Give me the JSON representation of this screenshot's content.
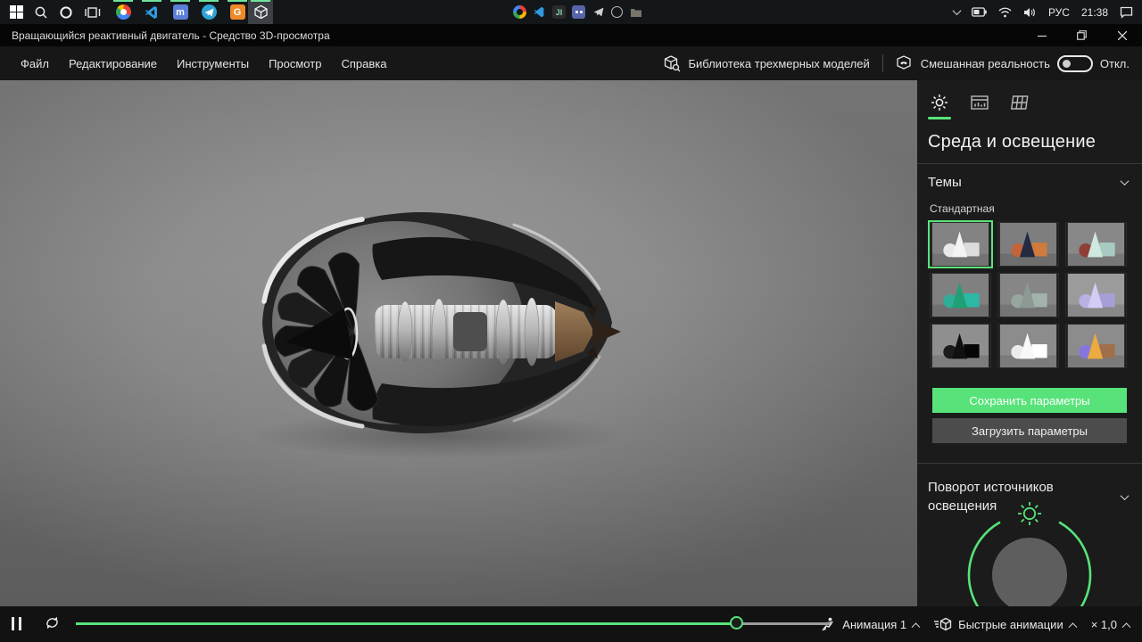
{
  "colors": {
    "accent": "#58e37a",
    "indicator": "#6fe39a"
  },
  "taskbar": {
    "language": "РУС",
    "time": "21:38"
  },
  "window": {
    "title": "Вращающийся реактивный двигатель - Средство 3D-просмотра"
  },
  "menubar": {
    "items": [
      "Файл",
      "Редактирование",
      "Инструменты",
      "Просмотр",
      "Справка"
    ],
    "library": "Библиотека трехмерных моделей",
    "mixed_reality": "Смешанная реальность",
    "mixed_reality_state": "Откл."
  },
  "sidebar": {
    "heading": "Среда и освещение",
    "themes_section": "Темы",
    "theme_selected_name": "Стандартная",
    "save_button": "Сохранить параметры",
    "load_button": "Загрузить параметры",
    "lighting_section": "Поворот источников освещения",
    "themes": [
      {
        "bg": "#838383",
        "sphere": "#e9e9e9",
        "cone": "#f4f4f4",
        "cube": "#dcdcdc"
      },
      {
        "bg": "#7e7e7e",
        "sphere": "#c4643a",
        "cone": "#232a42",
        "cube": "#d07a3e"
      },
      {
        "bg": "#888888",
        "sphere": "#8f3f36",
        "cone": "#cfe8e0",
        "cube": "#a7cbc2"
      },
      {
        "bg": "#808080",
        "sphere": "#2fae97",
        "cone": "#1fa075",
        "cube": "#2bb8a4"
      },
      {
        "bg": "#868686",
        "sphere": "#97a69e",
        "cone": "#8d9a93",
        "cube": "#a2b3ab"
      },
      {
        "bg": "#9b9b9b",
        "sphere": "#b7b1e4",
        "cone": "#d3cdf4",
        "cube": "#a59fd6"
      },
      {
        "bg": "#8f8f8f",
        "sphere": "#1b1b1b",
        "cone": "#101010",
        "cube": "#060606"
      },
      {
        "bg": "#8c8c8c",
        "sphere": "#ececec",
        "cone": "#f8f8f8",
        "cube": "#ffffff"
      },
      {
        "bg": "#8c8c8c",
        "sphere": "#8476dc",
        "cone": "#ebab3e",
        "cube": "#a06f4c"
      }
    ]
  },
  "playback": {
    "animation": "Анимация 1",
    "quick": "Быстрые анимации",
    "speed": "× 1,0",
    "progress_percent": 87.7
  }
}
